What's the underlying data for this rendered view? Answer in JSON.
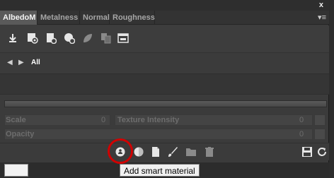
{
  "window": {
    "close_glyph": "x"
  },
  "tabs": [
    {
      "label": "AlbedoM",
      "active": true
    },
    {
      "label": "Metalness",
      "active": false
    },
    {
      "label": "Normal",
      "active": false
    },
    {
      "label": "Roughness",
      "active": false
    }
  ],
  "tab_menu_glyph": "▾≡",
  "toolbar": {
    "icons": [
      "download-icon",
      "save-gear-icon",
      "export-texture-icon",
      "add-brush-icon",
      "leaf-brush-icon",
      "duplicate-icon",
      "window-icon"
    ]
  },
  "nav": {
    "back_glyph": "◀",
    "forward_glyph": "▶",
    "current": "All"
  },
  "properties": {
    "scale_label": "Scale",
    "scale_value": "0",
    "texture_intensity_label": "Texture Intensity",
    "texture_intensity_value": "0",
    "opacity_label": "Opacity",
    "opacity_value": "0"
  },
  "bottom_toolbar": {
    "icons": [
      "add-smart-material-icon",
      "add-material-icon",
      "add-layer-icon",
      "add-brush-layer-icon",
      "add-folder-icon",
      "delete-icon",
      "save-icon",
      "refresh-icon"
    ]
  },
  "tooltip": {
    "text": "Add smart material"
  },
  "colors": {
    "highlight_ring": "#d10000",
    "active_tab": "#5a5a5a",
    "panel_bg": "#3b3b3b"
  }
}
